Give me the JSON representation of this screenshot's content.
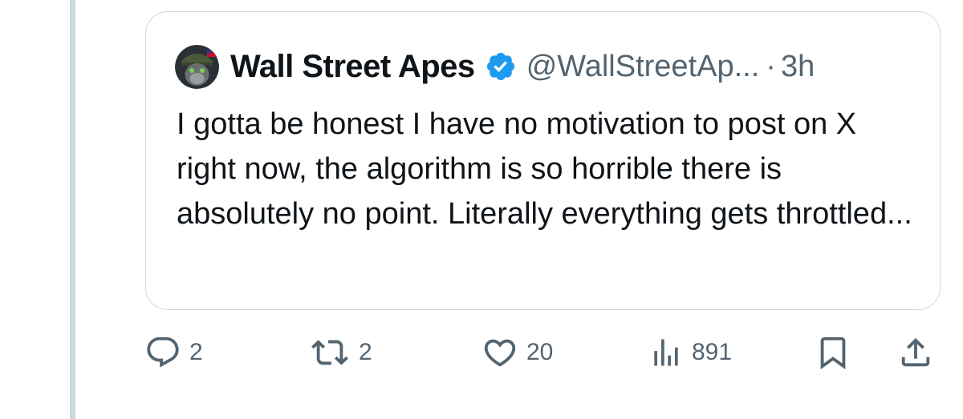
{
  "quoted_tweet": {
    "author_name": "Wall Street Apes",
    "handle": "@WallStreetAp...",
    "separator": "·",
    "time": "3h",
    "text": "I gotta be honest I have no motivation to post on X right now, the algorithm is so horrible there is absolutely no point. Literally everything gets throttled...",
    "verified_color": "#1d9bf0"
  },
  "actions": {
    "replies": "2",
    "reposts": "2",
    "likes": "20",
    "views": "891"
  },
  "icons": {
    "reply": "reply-icon",
    "repost": "repost-icon",
    "like": "heart-icon",
    "views": "views-bar-chart-icon",
    "bookmark": "bookmark-icon",
    "share": "share-icon"
  },
  "colors": {
    "text_primary": "#0f1419",
    "text_secondary": "#536471",
    "border": "#cfd9de"
  }
}
